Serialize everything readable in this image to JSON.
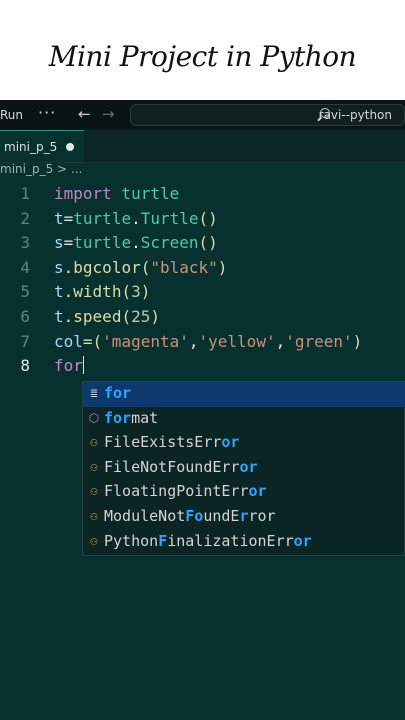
{
  "banner": {
    "title": "Mini Project in Python"
  },
  "topbar": {
    "run_label": "Run",
    "more_label": "···",
    "back_glyph": "←",
    "forward_glyph": "→",
    "search_text": "ravi--python"
  },
  "tab": {
    "name": "mini_p_5"
  },
  "breadcrumb": {
    "file": "mini_p_5",
    "sep": ">",
    "rest": "..."
  },
  "code": {
    "line_numbers": [
      "1",
      "2",
      "3",
      "4",
      "5",
      "6",
      "7",
      "8"
    ],
    "lines": [
      {
        "t1": "import",
        "t2": " turtle"
      },
      {
        "a": "t",
        "b": "=",
        "c": "turtle",
        "d": ".",
        "e": "Turtle",
        "f": "()"
      },
      {
        "a": "s",
        "b": "=",
        "c": "turtle",
        "d": ".",
        "e": "Screen",
        "f": "()"
      },
      {
        "a": "s",
        "b": ".",
        "c": "bgcolor",
        "d": "(",
        "e": "\"black\"",
        "f": ")"
      },
      {
        "a": "t",
        "b": ".",
        "c": "width",
        "d": "(",
        "e": "3",
        "f": ")"
      },
      {
        "a": "t",
        "b": ".",
        "c": "speed",
        "d": "(",
        "e": "25",
        "f": ")"
      },
      {
        "a": "col",
        "b": "=(",
        "c": "'magenta'",
        "d": ",",
        "e": "'yellow'",
        "f": ",",
        "g": "'green'",
        "h": ")"
      },
      {
        "typed": "for"
      }
    ]
  },
  "suggestions": [
    {
      "icon": "snippet-icon",
      "match": "for",
      "rest": ""
    },
    {
      "icon": "method-icon",
      "match": "for",
      "rest": "mat"
    },
    {
      "icon": "class-icon",
      "pre": "FileExistsErr",
      "match": "or",
      "rest": ""
    },
    {
      "icon": "class-icon",
      "pre": "FileNotFoundErr",
      "match": "or",
      "rest": ""
    },
    {
      "icon": "class-icon",
      "pre": "FloatingPointErr",
      "match": "or",
      "rest": ""
    },
    {
      "icon": "class-icon",
      "pre": "ModuleNot",
      "match": "Fo",
      "rest": "undE",
      "match2": "r",
      "rest2": "ror"
    },
    {
      "icon": "class-icon",
      "pre": "Python",
      "match": "F",
      "rest": "inalizationErr",
      "match2": "or",
      "rest2": ""
    }
  ],
  "colors": {
    "editor_bg": "#06312f",
    "selection": "#0d3a6e",
    "match": "#2aa7ff",
    "keyword": "#c586c0",
    "string": "#ce9178"
  }
}
